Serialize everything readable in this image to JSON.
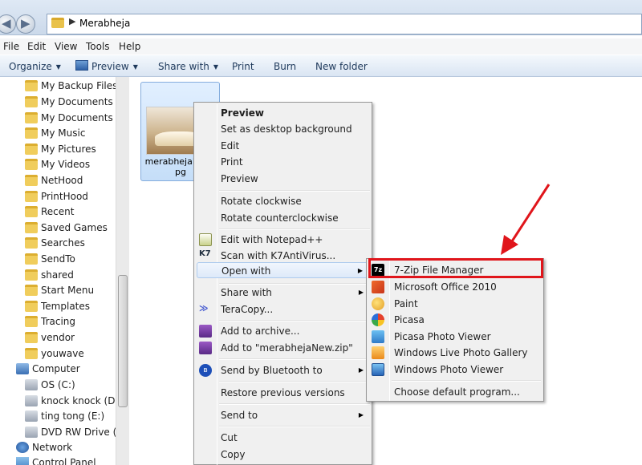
{
  "address": {
    "path": "Merabheja"
  },
  "menubar": {
    "items": [
      "File",
      "Edit",
      "View",
      "Tools",
      "Help"
    ]
  },
  "toolbar": {
    "organize": "Organize",
    "preview": "Preview",
    "share_with": "Share with",
    "print": "Print",
    "burn": "Burn",
    "new_folder": "New folder"
  },
  "navpane": {
    "items": [
      {
        "label": "My Backup Files",
        "icon": "folder-icon"
      },
      {
        "label": "My Documents",
        "icon": "folder-icon"
      },
      {
        "label": "My Documents",
        "icon": "folder-icon"
      },
      {
        "label": "My Music",
        "icon": "folder-icon"
      },
      {
        "label": "My Pictures",
        "icon": "folder-icon"
      },
      {
        "label": "My Videos",
        "icon": "folder-icon"
      },
      {
        "label": "NetHood",
        "icon": "folder-icon"
      },
      {
        "label": "PrintHood",
        "icon": "folder-icon"
      },
      {
        "label": "Recent",
        "icon": "folder-icon"
      },
      {
        "label": "Saved Games",
        "icon": "folder-icon"
      },
      {
        "label": "Searches",
        "icon": "folder-icon"
      },
      {
        "label": "SendTo",
        "icon": "folder-icon"
      },
      {
        "label": "shared",
        "icon": "folder-icon"
      },
      {
        "label": "Start Menu",
        "icon": "folder-icon"
      },
      {
        "label": "Templates",
        "icon": "folder-icon"
      },
      {
        "label": "Tracing",
        "icon": "folder-icon"
      },
      {
        "label": "vendor",
        "icon": "folder-icon"
      },
      {
        "label": "youwave",
        "icon": "folder-icon"
      },
      {
        "label": "Computer",
        "icon": "computer-icon"
      },
      {
        "label": "OS (C:)",
        "icon": "drive-icon"
      },
      {
        "label": "knock knock (D:)",
        "icon": "drive-icon"
      },
      {
        "label": "ting tong (E:)",
        "icon": "drive-icon"
      },
      {
        "label": "DVD RW Drive (G:)",
        "icon": "dvd-drive-icon"
      },
      {
        "label": "Network",
        "icon": "network-icon"
      },
      {
        "label": "Control Panel",
        "icon": "control-panel-icon"
      }
    ]
  },
  "file": {
    "label": "merabhejaNew.jpg"
  },
  "context_menu": {
    "items": [
      {
        "label": "Preview",
        "bold": true
      },
      {
        "label": "Set as desktop background"
      },
      {
        "label": "Edit"
      },
      {
        "label": "Print"
      },
      {
        "label": "Preview"
      },
      {
        "label": "Rotate clockwise"
      },
      {
        "label": "Rotate counterclockwise"
      },
      {
        "label": "Edit with Notepad++",
        "icon": "notepad-plus-icon"
      },
      {
        "label": "Scan with K7AntiVirus...",
        "icon": "k7-antivirus-icon",
        "icon_text": "K7"
      },
      {
        "label": "Open with",
        "submenu": true
      },
      {
        "label": "Share with",
        "submenu": true
      },
      {
        "label": "TeraCopy...",
        "icon": "teracopy-icon",
        "icon_text": "≫"
      },
      {
        "label": "Add to archive...",
        "icon": "winrar-icon"
      },
      {
        "label": "Add to \"merabhejaNew.zip\"",
        "icon": "winrar-icon"
      },
      {
        "label": "Send by Bluetooth to",
        "icon": "bluetooth-icon",
        "icon_text": "ʙ",
        "submenu": true
      },
      {
        "label": "Restore previous versions"
      },
      {
        "label": "Send to",
        "submenu": true
      },
      {
        "label": "Cut"
      },
      {
        "label": "Copy"
      }
    ]
  },
  "open_with_submenu": {
    "items": [
      {
        "label": "7-Zip File Manager",
        "icon": "7zip-icon",
        "icon_text": "7z"
      },
      {
        "label": "Microsoft Office 2010",
        "icon": "office-icon"
      },
      {
        "label": "Paint",
        "icon": "paint-icon"
      },
      {
        "label": "Picasa",
        "icon": "picasa-icon"
      },
      {
        "label": "Picasa Photo Viewer",
        "icon": "picasa-viewer-icon"
      },
      {
        "label": "Windows Live Photo Gallery",
        "icon": "photo-gallery-icon"
      },
      {
        "label": "Windows Photo Viewer",
        "icon": "photo-viewer-icon"
      },
      {
        "label": "Choose default program..."
      }
    ]
  },
  "colors": {
    "highlight_red": "#e0151b",
    "selection_blue": "#c5def8"
  }
}
